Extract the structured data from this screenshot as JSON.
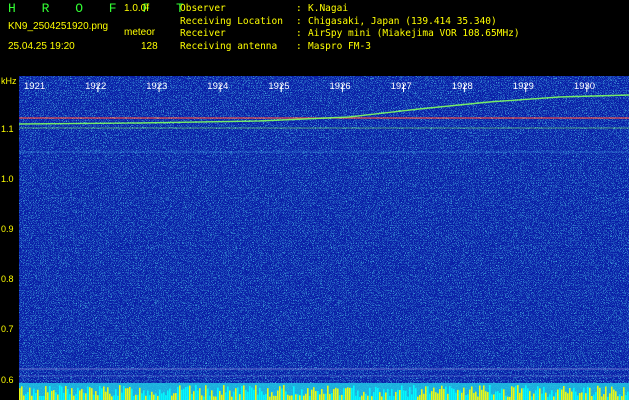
{
  "header": {
    "brand": "H R O F F T",
    "version": "1.0.0f",
    "file_name": "KN9_2504251920.png",
    "mode": "meteor",
    "timestamp": "25.04.25 19:20",
    "fft_size": "128"
  },
  "station_info": [
    {
      "key": "Observer",
      "value": "K.Nagai"
    },
    {
      "key": "Receiving Location",
      "value": "Chigasaki, Japan (139.414 35.340)"
    },
    {
      "key": "Receiver",
      "value": "AirSpy mini (Miakejima VOR 108.65MHz)"
    },
    {
      "key": "Receiving antenna",
      "value": "Maspro FM-3"
    }
  ],
  "y_axis": {
    "unit": "kHz",
    "ticks": [
      "1.1",
      "1.0",
      "0.9",
      "0.8",
      "0.7",
      "0.6"
    ]
  },
  "time_axis": {
    "ticks": [
      "1921",
      "1922",
      "1923",
      "1924",
      "1925",
      "1926",
      "1927",
      "1928",
      "1929",
      "1930"
    ]
  },
  "colors": {
    "label_yellow": "#ffff00",
    "brand_green": "#33ff33",
    "background_blue": "#0a1fa8",
    "speckle_cyan": "#20c8e6",
    "carrier_green": "#80ff60",
    "carrier_red": "#ff5040"
  }
}
